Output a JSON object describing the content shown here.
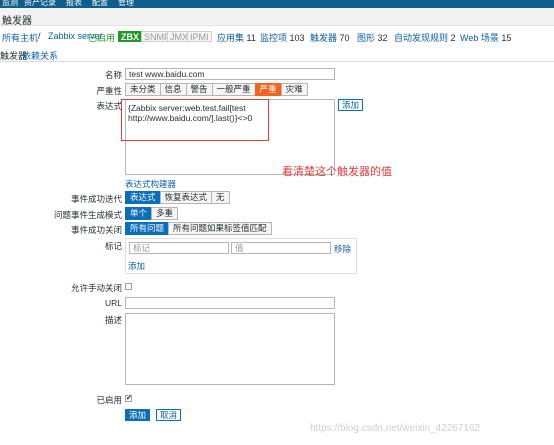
{
  "top_nav": [
    "监测",
    "资产记录",
    "报表",
    "配置",
    "管理"
  ],
  "sub_header": {
    "title": "触发器"
  },
  "breadcrumb": {
    "all_hosts": "所有主机",
    "separator": " / ",
    "host": "Zabbix server",
    "enabled": "已启用",
    "badges": [
      "ZBX",
      "SNMP",
      "JMX",
      "IPMI"
    ],
    "links": [
      {
        "label": "应用集",
        "count": "11"
      },
      {
        "label": "监控项",
        "count": "103"
      },
      {
        "label": "触发器",
        "count": "70"
      },
      {
        "label": "图形",
        "count": "32"
      },
      {
        "label": "自动发现规则",
        "count": "2"
      },
      {
        "label": "Web 场景",
        "count": "15"
      }
    ]
  },
  "tabs": {
    "trigger": "触发器",
    "dependencies": "依赖关系"
  },
  "form": {
    "name": {
      "label": "名称",
      "value": "test www.baidu.com"
    },
    "severity": {
      "label": "严重性",
      "options": [
        "未分类",
        "信息",
        "警告",
        "一般严重",
        "严重",
        "灾难"
      ],
      "selected": "严重"
    },
    "expression": {
      "label": "表达式",
      "line1": "{Zabbix server:web.test.fail[test",
      "line2": "http://www.baidu.com/].last()}<>0",
      "add_button": "添加",
      "builder_link": "表达式构建器"
    },
    "annotation": "看清楚这个触发器的值",
    "recovery_mode": {
      "label": "事件成功迭代",
      "options": [
        "表达式",
        "恢复表达式",
        "无"
      ],
      "selected": "表达式"
    },
    "problem_mode": {
      "label": "问题事件生成模式",
      "options": [
        "单个",
        "多重"
      ],
      "selected": "单个"
    },
    "ok_close": {
      "label": "事件成功关闭",
      "options": [
        "所有问题",
        "所有问题如果标签值匹配"
      ],
      "selected": "所有问题"
    },
    "tags": {
      "label": "标记",
      "tag_placeholder": "标记",
      "value_placeholder": "值",
      "remove": "移除",
      "add": "添加"
    },
    "manual_close": {
      "label": "允许手动关闭"
    },
    "url": {
      "label": "URL",
      "value": ""
    },
    "description": {
      "label": "描述"
    },
    "enabled": {
      "label": "已启用",
      "checked": "✔"
    },
    "buttons": {
      "add": "添加",
      "cancel": "取消"
    }
  },
  "watermark": "https://blog.csdn.net/weixin_42267162",
  "colors": {
    "header_blue": "#0e5e8c",
    "selected_blue": "#0a6fb8",
    "severity_high": "#f0651a",
    "annotation_red": "#e33b3b",
    "enabled_green": "#229a2b"
  }
}
